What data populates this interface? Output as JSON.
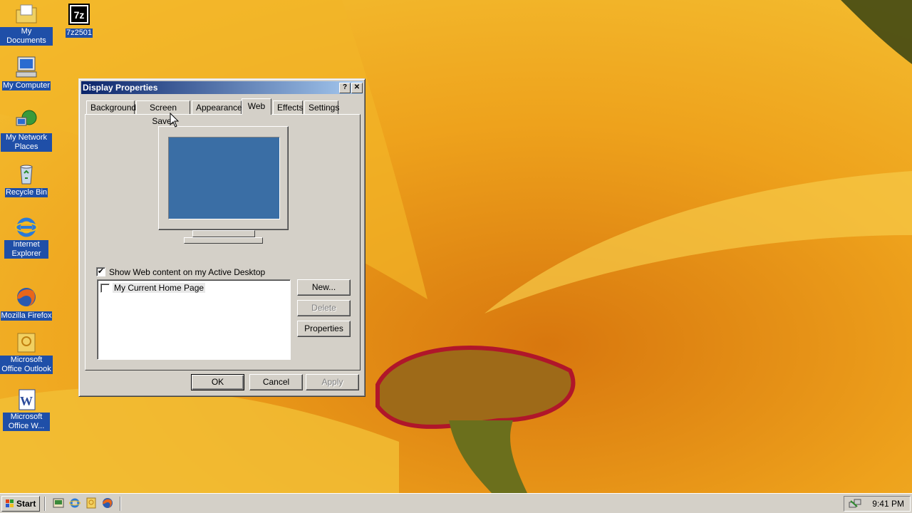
{
  "desktop": {
    "icons": [
      {
        "label": "My Documents",
        "icon": "my-documents-icon"
      },
      {
        "label": "7z2501",
        "icon": "7zip-icon",
        "glyph": "7z"
      },
      {
        "label": "My Computer",
        "icon": "my-computer-icon"
      },
      {
        "label": "My Network Places",
        "icon": "network-places-icon"
      },
      {
        "label": "Recycle Bin",
        "icon": "recycle-bin-icon"
      },
      {
        "label": "Internet Explorer",
        "icon": "internet-explorer-icon"
      },
      {
        "label": "Mozilla Firefox",
        "icon": "firefox-icon"
      },
      {
        "label": "Microsoft Office Outlook",
        "icon": "outlook-icon"
      },
      {
        "label": "Microsoft Office W...",
        "icon": "word-icon"
      }
    ]
  },
  "dialog": {
    "title": "Display Properties",
    "help_glyph": "?",
    "close_glyph": "✕",
    "tabs": [
      {
        "label": "Background"
      },
      {
        "label": "Screen Saver"
      },
      {
        "label": "Appearance"
      },
      {
        "label": "Web",
        "active": true
      },
      {
        "label": "Effects"
      },
      {
        "label": "Settings"
      }
    ],
    "show_web_content": {
      "label": "Show Web content on my Active Desktop",
      "checked": true
    },
    "list_items": [
      {
        "label": "My Current Home Page",
        "checked": false
      }
    ],
    "side_buttons": {
      "new": "New...",
      "delete": "Delete",
      "properties": "Properties"
    },
    "footer_buttons": {
      "ok": "OK",
      "cancel": "Cancel",
      "apply": "Apply"
    },
    "check_glyph": "✔"
  },
  "taskbar": {
    "start_label": "Start",
    "clock": "9:41 PM",
    "quick_launch": [
      "show-desktop-icon",
      "internet-explorer-icon",
      "outlook-icon",
      "firefox-icon"
    ]
  },
  "colors": {
    "desktop_selection": "#1f4fa8",
    "title_gradient_start": "#0a246a",
    "title_gradient_end": "#a6caf0",
    "preview_screen": "#3a6ea5",
    "dialog_face": "#d4d0c8"
  }
}
